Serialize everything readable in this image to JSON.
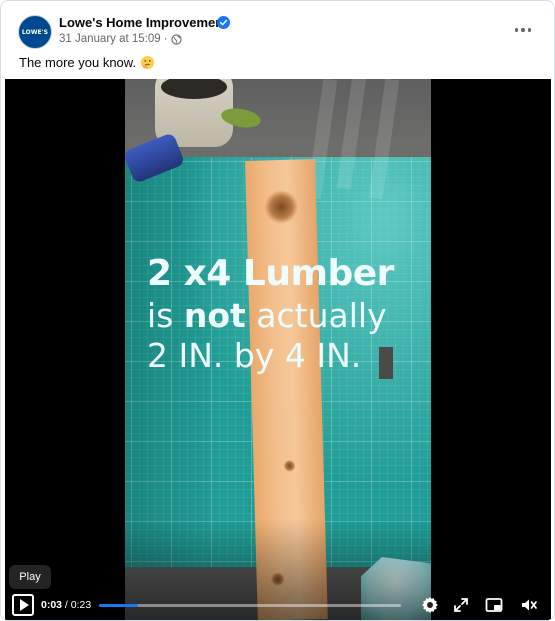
{
  "post": {
    "page_name": "Lowe's Home Improvement",
    "verified": true,
    "timestamp": "31 January at 15:09",
    "separator": "·",
    "audience_icon": "globe-icon",
    "avatar_text": "LOWE'S",
    "caption": "The more you know.",
    "caption_emoji": "thinking-face-emoji"
  },
  "video": {
    "overlay": {
      "line1": "2 x4 Lumber",
      "line2_pre": "is ",
      "line2_bold": "not",
      "line2_post": " actually",
      "line3": "2 IN. by 4 IN."
    },
    "tooltip": "Play",
    "current_time": "0:03",
    "time_sep": " / ",
    "duration": "0:23",
    "progress": 0.13,
    "icons": [
      "play-icon",
      "settings-gear-icon",
      "fullscreen-icon",
      "picture-in-picture-icon",
      "volume-muted-icon"
    ]
  },
  "colors": {
    "accent": "#1877f2",
    "verified_badge": "#1877f2",
    "brand": "#004990"
  }
}
